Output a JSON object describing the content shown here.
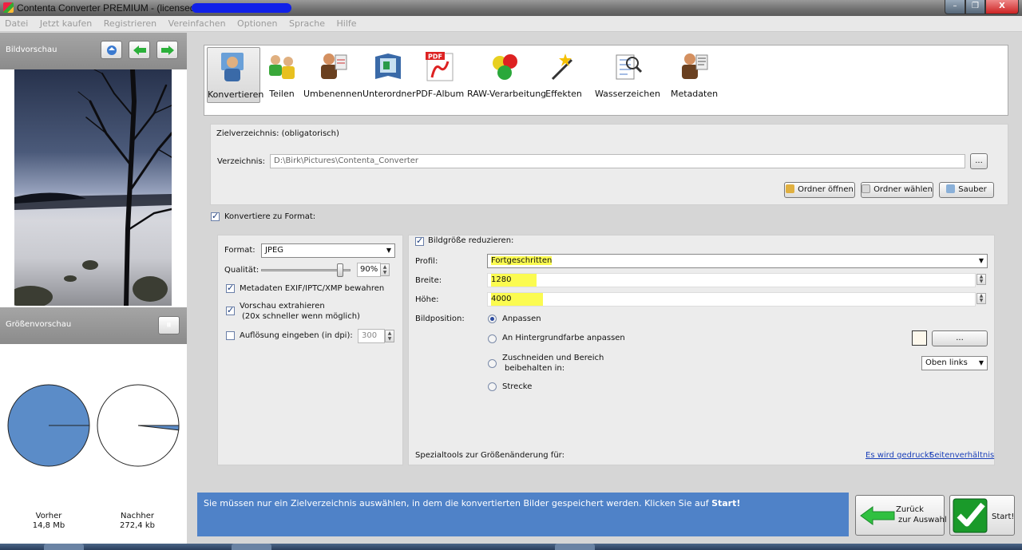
{
  "window": {
    "title": "Contenta Converter PREMIUM  - (licensed to",
    "minimize_glyph": "–",
    "maximize_glyph": "❐",
    "close_glyph": "X"
  },
  "menu": [
    "Datei",
    "Jetzt kaufen",
    "Registrieren",
    "Vereinfachen",
    "Optionen",
    "Sprache",
    "Hilfe"
  ],
  "sidebar": {
    "preview_title": "Bildvorschau",
    "size_preview_title": "Größenvorschau",
    "pause_glyph": "⏸",
    "before_label": "Vorher",
    "before_value": "14,8 Mb",
    "after_label": "Nachher",
    "after_value": "272,4 kb",
    "pie_after_fraction": 0.018
  },
  "tools": [
    {
      "label": "Konvertieren",
      "icon": "person-convert-icon"
    },
    {
      "label": "Teilen",
      "icon": "people-share-icon"
    },
    {
      "label": "Umbenennen",
      "icon": "person-rename-icon"
    },
    {
      "label": "Unterordner",
      "icon": "folder-book-icon"
    },
    {
      "label": "PDF-Album",
      "icon": "pdf-icon"
    },
    {
      "label": "RAW-Verarbeitung",
      "icon": "raw-balls-icon"
    },
    {
      "label": "Effekten",
      "icon": "magic-wand-icon"
    },
    {
      "label": "Wasserzeichen",
      "icon": "magnifier-list-icon"
    },
    {
      "label": "Metadaten",
      "icon": "person-metadata-icon"
    }
  ],
  "pdf_badge": "PDF",
  "target": {
    "section_title": "Zielverzeichnis: (obligatorisch)",
    "dir_label": "Verzeichnis:",
    "dir_value": "D:\\Birk\\Pictures\\Contenta_Converter",
    "browse_label": "...",
    "open_folder": "Ordner öffnen",
    "choose_folder": "Ordner wählen",
    "clean": "Sauber"
  },
  "convert": {
    "checkbox_label": "Konvertiere zu Format:",
    "format_label": "Format:",
    "format_value": "JPEG",
    "quality_label": "Qualität:",
    "quality_value": "90%",
    "quality_fraction": 0.9,
    "keep_meta": "Metadaten EXIF/IPTC/XMP bewahren",
    "extract_preview": "Vorschau extrahieren",
    "extract_preview_note": "(20x schneller wenn möglich)",
    "dpi_label": "Auflösung eingeben (in dpi):",
    "dpi_value": "300"
  },
  "resize": {
    "checkbox_label": "Bildgröße reduzieren:",
    "profile_label": "Profil:",
    "profile_value": "Fortgeschritten",
    "width_label": "Breite:",
    "width_value": "1280",
    "height_label": "Höhe:",
    "height_value": "4000",
    "position_label": "Bildposition:",
    "opt_fit": "Anpassen",
    "opt_bg": "An Hintergrundfarbe anpassen",
    "opt_crop_1": "Zuschneiden und Bereich",
    "opt_crop_2": "beibehalten in:",
    "opt_stretch": "Strecke",
    "bg_button": "...",
    "crop_anchor": "Oben links",
    "special_tools": "Spezialtools zur Größenänderung für:",
    "link_print": "Es wird gedruckt",
    "link_ratio": "Seitenverhältnis"
  },
  "info": {
    "text": "Sie müssen nur ein Zielverzeichnis auswählen, in dem die konvertierten Bilder gespeichert werden. Klicken Sie auf ",
    "bold": "Start!"
  },
  "back_button": {
    "line1": "Zurück",
    "line2": "zur Auswahl"
  },
  "start_button": "Start!"
}
